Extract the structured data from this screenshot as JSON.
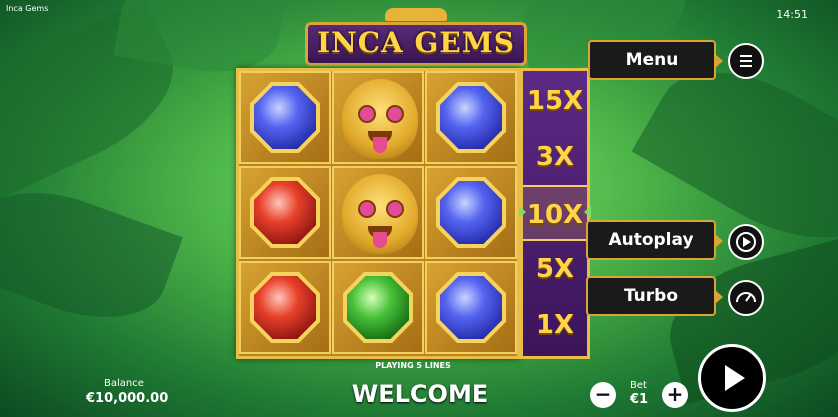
{
  "window": {
    "title": "Inca Gems",
    "clock": "14:51"
  },
  "logo": {
    "text": "INCA GEMS"
  },
  "reels": {
    "rows": [
      [
        "gem-blue",
        "mask",
        "gem-blue"
      ],
      [
        "gem-red",
        "mask",
        "gem-blue"
      ],
      [
        "gem-red",
        "gem-green",
        "gem-blue"
      ]
    ]
  },
  "multipliers": {
    "items": [
      "15X",
      "3X",
      "10X",
      "5X",
      "1X"
    ],
    "active": "10X"
  },
  "lines": {
    "text": "PLAYING 5 LINES"
  },
  "menu": {
    "label": "Menu"
  },
  "autoplay": {
    "label": "Autoplay"
  },
  "turbo": {
    "label": "Turbo"
  },
  "balance": {
    "label": "Balance",
    "value": "€10,000.00"
  },
  "message": {
    "text": "WELCOME"
  },
  "bet": {
    "label": "Bet",
    "value": "€1",
    "minus": "−",
    "plus": "+"
  },
  "colors": {
    "gold": "#d9a534",
    "purple": "#3b1459",
    "mult_text": "#ffd447"
  }
}
